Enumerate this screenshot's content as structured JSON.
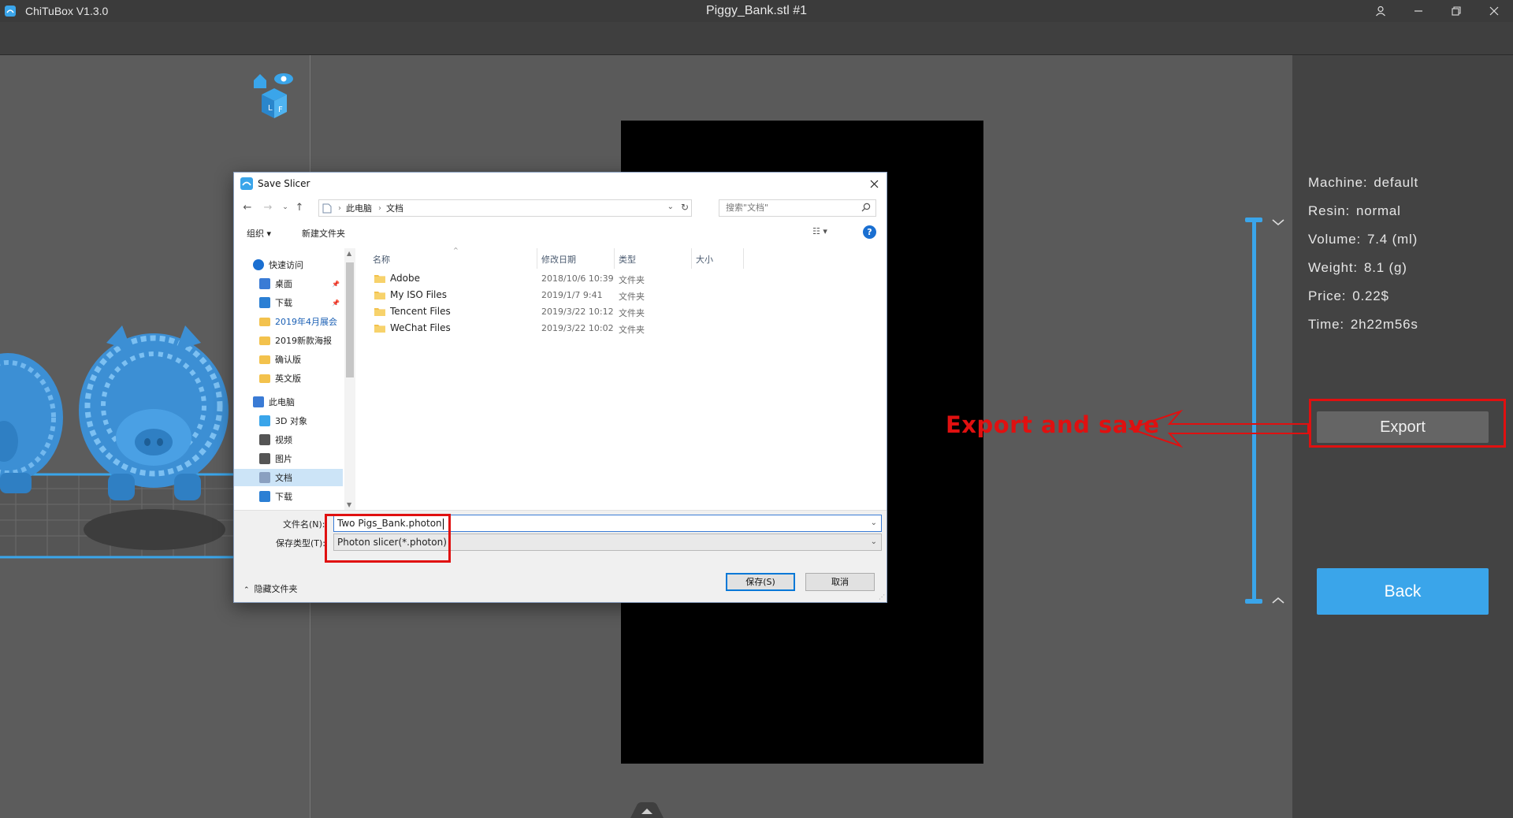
{
  "app": {
    "name": "ChiTuBox V1.3.0",
    "document_title": "Piggy_Bank.stl #1"
  },
  "info": [
    {
      "key": "Machine:",
      "value": "default"
    },
    {
      "key": "Resin:",
      "value": "normal"
    },
    {
      "key": "Volume:",
      "value": "7.4  (ml)"
    },
    {
      "key": "Weight:",
      "value": "8.1  (g)"
    },
    {
      "key": "Price:",
      "value": "0.22$"
    },
    {
      "key": "Time:",
      "value": "2h22m56s"
    }
  ],
  "buttons": {
    "export": "Export",
    "back": "Back"
  },
  "annotation": {
    "text": "Export and save",
    "color": "#e01010"
  },
  "colors": {
    "accent": "#3aa5ea",
    "highlight": "#e01010"
  },
  "dialog": {
    "title": "Save Slicer",
    "address": [
      "此电脑",
      "文档"
    ],
    "search_placeholder": "搜索\"文档\"",
    "commands": {
      "organize": "组织 ▾",
      "new_folder": "新建文件夹"
    },
    "nav_items": [
      {
        "label": "快速访问",
        "icon": "star-icon",
        "indent": 0,
        "pinned": false
      },
      {
        "label": "桌面",
        "icon": "desktop-icon",
        "indent": 1,
        "pinned": true
      },
      {
        "label": "下载",
        "icon": "download-icon",
        "indent": 1,
        "pinned": true
      },
      {
        "label": "2019年4月展会",
        "icon": "folder-icon",
        "indent": 1,
        "pinned": false,
        "link": true
      },
      {
        "label": "2019新款海报",
        "icon": "folder-icon",
        "indent": 1,
        "pinned": false
      },
      {
        "label": "确认版",
        "icon": "folder-icon",
        "indent": 1,
        "pinned": false
      },
      {
        "label": "英文版",
        "icon": "folder-icon",
        "indent": 1,
        "pinned": false
      },
      {
        "label": "此电脑",
        "icon": "computer-icon",
        "indent": 0,
        "pinned": false
      },
      {
        "label": "3D 对象",
        "icon": "cube-icon",
        "indent": 1,
        "pinned": false
      },
      {
        "label": "视频",
        "icon": "video-icon",
        "indent": 1,
        "pinned": false
      },
      {
        "label": "图片",
        "icon": "picture-icon",
        "indent": 1,
        "pinned": false
      },
      {
        "label": "文档",
        "icon": "document-icon",
        "indent": 1,
        "pinned": false,
        "selected": true
      },
      {
        "label": "下载",
        "icon": "download-icon",
        "indent": 1,
        "pinned": false
      }
    ],
    "columns": [
      "名称",
      "修改日期",
      "类型",
      "大小"
    ],
    "files": [
      {
        "name": "Adobe",
        "date": "2018/10/6 10:39",
        "type": "文件夹"
      },
      {
        "name": "My ISO Files",
        "date": "2019/1/7 9:41",
        "type": "文件夹"
      },
      {
        "name": "Tencent Files",
        "date": "2019/3/22 10:12",
        "type": "文件夹"
      },
      {
        "name": "WeChat Files",
        "date": "2019/3/22 10:02",
        "type": "文件夹"
      }
    ],
    "filename_label": "文件名(N):",
    "filename_value": "Two Pigs_Bank.photon",
    "filetype_label": "保存类型(T):",
    "filetype_value": "Photon slicer(*.photon)",
    "hide_folders": "隐藏文件夹",
    "save": "保存(S)",
    "cancel": "取消"
  }
}
